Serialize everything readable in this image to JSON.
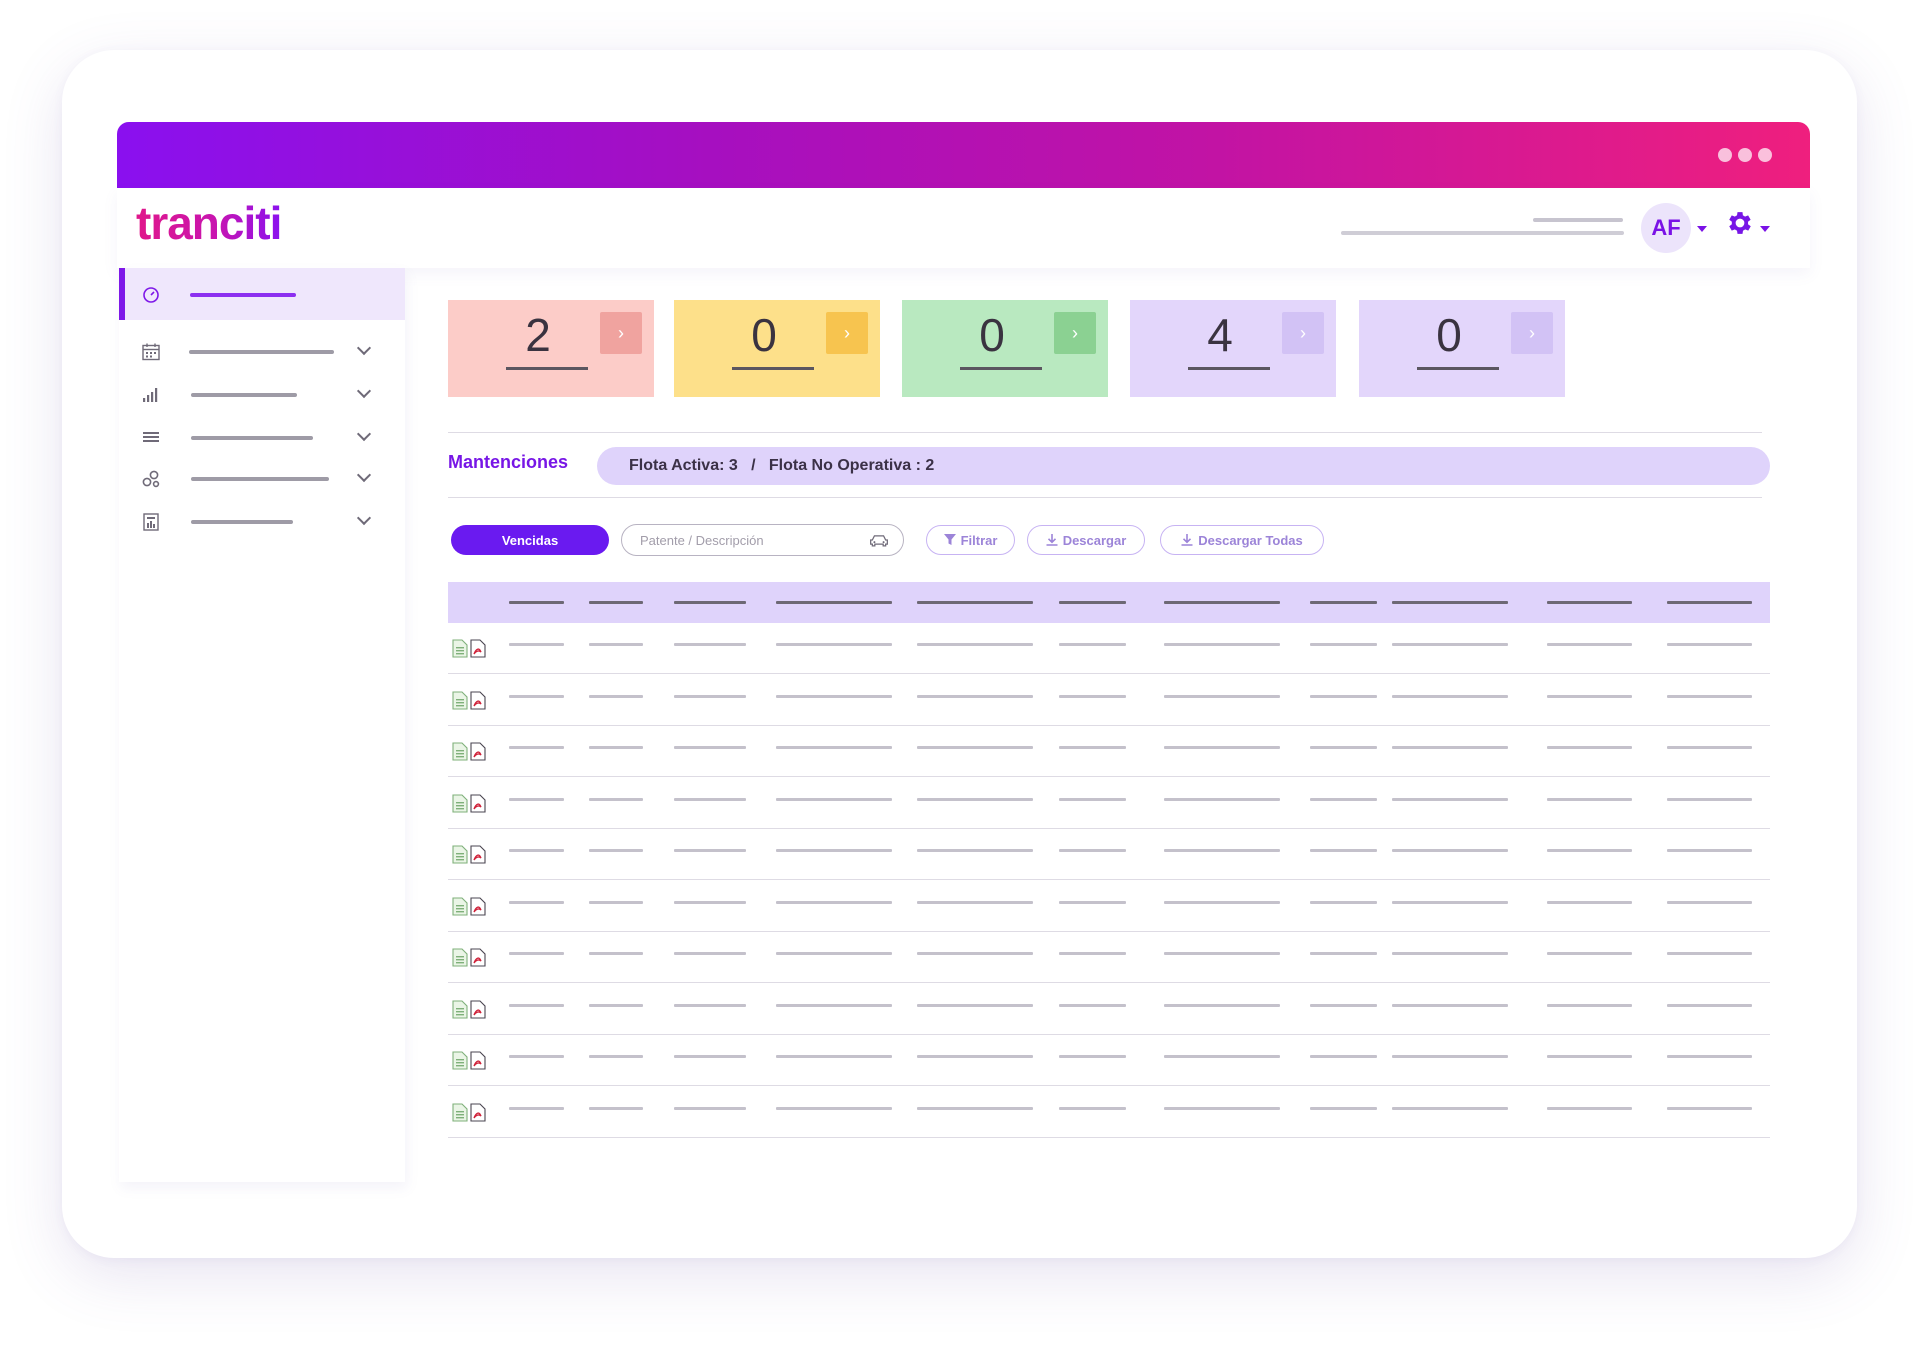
{
  "header": {
    "logo": "tranciti",
    "avatar_initials": "AF"
  },
  "colors": {
    "accent": "#7716e6",
    "gradient_start": "#8a10ef",
    "gradient_end": "#ef1f7e"
  },
  "stats": [
    {
      "value": "2",
      "bg": "#fcccc8",
      "arrow_bg": "#f0a39f"
    },
    {
      "value": "0",
      "bg": "#fde08a",
      "arrow_bg": "#f7c44f"
    },
    {
      "value": "0",
      "bg": "#b9e9c0",
      "arrow_bg": "#8bd192"
    },
    {
      "value": "4",
      "bg": "#e3d6fb",
      "arrow_bg": "#d2c2f5"
    },
    {
      "value": "0",
      "bg": "#e3d6fb",
      "arrow_bg": "#d2c2f5"
    }
  ],
  "section": {
    "title": "Mantenciones",
    "fleet_summary": "Flota Activa: 3   /   Flota No Operativa : 2"
  },
  "toolbar": {
    "tab_label": "Vencidas",
    "search_placeholder": "Patente / Descripción",
    "filter_label": "Filtrar",
    "download_label": "Descargar",
    "download_all_label": "Descargar Todas"
  },
  "icons": {
    "sidebar": [
      "dashboard-icon",
      "calendar-icon",
      "signal-bars-icon",
      "list-icon",
      "gears-icon",
      "report-icon"
    ],
    "row_actions": [
      "excel-file-icon",
      "pdf-file-icon"
    ],
    "search": "car-icon",
    "settings": "gear-icon"
  }
}
